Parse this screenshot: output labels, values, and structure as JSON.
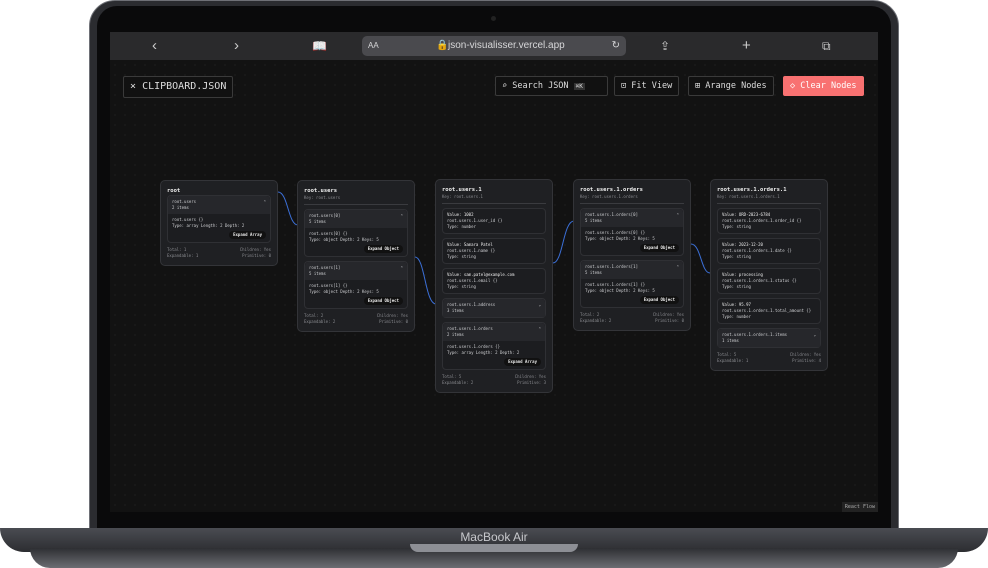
{
  "device": {
    "label": "MacBook Air"
  },
  "browser": {
    "url": "json-visualisser.vercel.app",
    "aa": "AA",
    "icons": [
      "chevron-left-icon",
      "chevron-right-icon",
      "book-icon",
      "lock-icon",
      "reload-icon",
      "share-icon",
      "plus-icon",
      "tabs-icon"
    ]
  },
  "toolbar": {
    "file_label": "CLIPBOARD.JSON",
    "close_glyph": "×",
    "search_label": "Search JSON",
    "shortcut": "⌘K",
    "fit_label": "Fit View",
    "arrange_label": "Arange Nodes",
    "clear_label": "Clear Nodes",
    "clear_color": "#f87171"
  },
  "nodes": [
    {
      "title": "root",
      "key": "",
      "cards": [
        {
          "header": "root.users",
          "sub": "2 items",
          "path": "root.users {}",
          "type": "Type: array Length: 2 Depth: 2",
          "button": "Expand Array"
        }
      ],
      "foot": [
        "Total: 1",
        "Children: Yes",
        "Expandable: 1",
        "Primitive: 0"
      ]
    },
    {
      "title": "root.users",
      "key": "Key: root.users",
      "cards": [
        {
          "header": "root.users[0]",
          "sub": "5 items",
          "path": "root.users[0] {}",
          "type": "Type: object Depth: 2 Keys: 5",
          "button": "Expand Object"
        },
        {
          "header": "root.users[1]",
          "sub": "5 items",
          "path": "root.users[1] {}",
          "type": "Type: object Depth: 2 Keys: 5",
          "button": "Expand Object"
        }
      ],
      "foot": [
        "Total: 2",
        "Children: Yes",
        "Expandable: 2",
        "Primitive: 0"
      ]
    },
    {
      "title": "root.users.1",
      "key": "Key: root.users.1",
      "values": [
        {
          "value": "Value: 1002",
          "path": "root.users.1.user_id {}",
          "type": "Type: number"
        },
        {
          "value": "Value: Samara Patel",
          "path": "root.users.1.name {}",
          "type": "Type: string"
        },
        {
          "value": "Value: sam.patel@example.com",
          "path": "root.users.1.email {}",
          "type": "Type: string"
        }
      ],
      "collapsed": [
        {
          "header": "root.users.1.address",
          "sub": "3 items"
        }
      ],
      "cards": [
        {
          "header": "root.users.1.orders",
          "sub": "2 items",
          "path": "root.users.1.orders {}",
          "type": "Type: array Length: 2 Depth: 2",
          "button": "Expand Array"
        }
      ],
      "foot": [
        "Total: 5",
        "Children: Yes",
        "Expandable: 2",
        "Primitive: 3"
      ]
    },
    {
      "title": "root.users.1.orders",
      "key": "Key: root.users.1.orders",
      "cards": [
        {
          "header": "root.users.1.orders[0]",
          "sub": "5 items",
          "path": "root.users.1.orders[0] {}",
          "type": "Type: object Depth: 2 Keys: 5",
          "button": "Expand Object"
        },
        {
          "header": "root.users.1.orders[1]",
          "sub": "5 items",
          "path": "root.users.1.orders[1] {}",
          "type": "Type: object Depth: 2 Keys: 5",
          "button": "Expand Object"
        }
      ],
      "foot": [
        "Total: 2",
        "Children: Yes",
        "Expandable: 2",
        "Primitive: 0"
      ]
    },
    {
      "title": "root.users.1.orders.1",
      "key": "Key: root.users.1.orders.1",
      "values": [
        {
          "value": "Value: ORD-2023-6784",
          "path": "root.users.1.orders.1.order_id {}",
          "type": "Type: string"
        },
        {
          "value": "Value: 2023-12-20",
          "path": "root.users.1.orders.1.date {}",
          "type": "Type: string"
        },
        {
          "value": "Value: processing",
          "path": "root.users.1.orders.1.status {}",
          "type": "Type: string"
        },
        {
          "value": "Value: 95.97",
          "path": "root.users.1.orders.1.total_amount {}",
          "type": "Type: number"
        }
      ],
      "collapsed": [
        {
          "header": "root.users.1.orders.1.items",
          "sub": "1 items"
        }
      ],
      "cards": [],
      "foot": [
        "Total: 5",
        "Children: Yes",
        "Expandable: 1",
        "Primitive: 4"
      ]
    }
  ],
  "attribution": "React Flow"
}
